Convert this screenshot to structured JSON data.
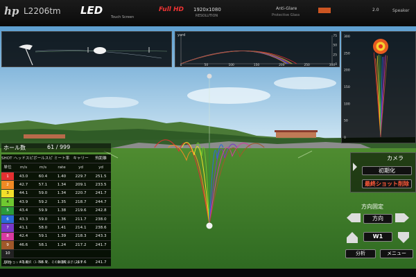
{
  "bezel": {
    "brand": "hp",
    "model": "L2206tm",
    "led": "LED",
    "touch_screen": "Touch Screen",
    "full_hd": "Full HD",
    "resolution": "1920x1080",
    "resolution_label": "RESOLUTION",
    "anti_glare": "Anti-Glare",
    "protective_glass": "Protective Glass",
    "version": "2.0",
    "speakers": "Speaker"
  },
  "top_chart": {
    "y_label": "yard",
    "y_ticks": [
      "75",
      "50",
      "25",
      "0"
    ],
    "x_ticks": [
      "0",
      "50",
      "100",
      "150",
      "200",
      "250",
      "300"
    ]
  },
  "dispersion_chart": {
    "y_ticks": [
      "300",
      "250",
      "200",
      "150",
      "100",
      "50",
      "0"
    ]
  },
  "hole_counter": {
    "label": "ホール数",
    "value": "61 / 999"
  },
  "table": {
    "headers": [
      "SHOT NO",
      "ヘッドスピード",
      "ボールスピード",
      "ミート率",
      "キャリー",
      "飛距離"
    ],
    "units": [
      "単位",
      "m/s",
      "m/s",
      "rate",
      "yd",
      "yd"
    ],
    "rows": [
      {
        "n": "1",
        "color": "#e53030",
        "head": "43.0",
        "ball": "60.4",
        "rate": "1.40",
        "carry": "229.7",
        "total": "251.5"
      },
      {
        "n": "2",
        "color": "#f08a24",
        "head": "42.7",
        "ball": "57.1",
        "rate": "1.34",
        "carry": "209.1",
        "total": "233.5"
      },
      {
        "n": "3",
        "color": "#f2df2a",
        "head": "44.1",
        "ball": "59.0",
        "rate": "1.34",
        "carry": "220.7",
        "total": "241.7"
      },
      {
        "n": "4",
        "color": "#6fc830",
        "head": "43.9",
        "ball": "59.2",
        "rate": "1.35",
        "carry": "218.7",
        "total": "244.7"
      },
      {
        "n": "5",
        "color": "#2a9a3a",
        "head": "43.4",
        "ball": "59.9",
        "rate": "1.38",
        "carry": "219.6",
        "total": "242.8"
      },
      {
        "n": "6",
        "color": "#2a6ad8",
        "head": "43.3",
        "ball": "59.0",
        "rate": "1.36",
        "carry": "211.7",
        "total": "238.0"
      },
      {
        "n": "7",
        "color": "#7a38c8",
        "head": "41.1",
        "ball": "58.0",
        "rate": "1.41",
        "carry": "214.1",
        "total": "238.6"
      },
      {
        "n": "8",
        "color": "#d83aa0",
        "head": "42.4",
        "ball": "59.1",
        "rate": "1.39",
        "carry": "218.3",
        "total": "243.3"
      },
      {
        "n": "9",
        "color": "#a0582a",
        "head": "46.6",
        "ball": "58.1",
        "rate": "1.24",
        "carry": "217.2",
        "total": "241.7"
      },
      {
        "n": "10",
        "color": "#222222",
        "head": "",
        "ball": "",
        "rate": "",
        "carry": "",
        "total": ""
      }
    ],
    "average": {
      "label": "平均",
      "head": "43.4",
      "ball": "58.9",
      "rate": "1.36",
      "carry": "217.6",
      "total": "241.7"
    },
    "footer": "上のショットを選択（1-10）で、その弾道を表示します"
  },
  "controls": {
    "camera": "カメラ",
    "reset": "初期化",
    "latest_shot": "最終ショット削除",
    "direction_fixed": "方向固定",
    "direction": "方向",
    "club": "W1",
    "analysis": "分析",
    "menu": "メニュー"
  },
  "colors": {
    "accent_red": "#ff5a3a",
    "grass": "#3f7f2a",
    "sky": "#9cc9e6"
  }
}
